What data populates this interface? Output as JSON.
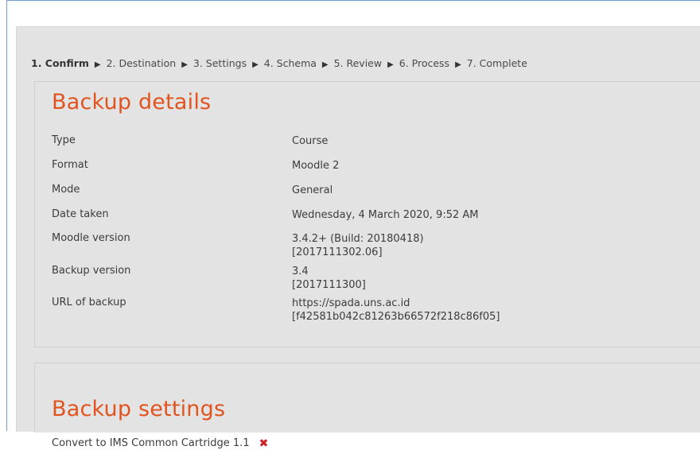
{
  "progress": {
    "steps": [
      "1. Confirm",
      "2. Destination",
      "3. Settings",
      "4. Schema",
      "5. Review",
      "6. Process",
      "7. Complete"
    ],
    "separator": "▶"
  },
  "backup_details": {
    "title": "Backup details",
    "rows": [
      {
        "label": "Type",
        "value": "Course"
      },
      {
        "label": "Format",
        "value": "Moodle 2"
      },
      {
        "label": "Mode",
        "value": "General"
      },
      {
        "label": "Date taken",
        "value": "Wednesday, 4 March 2020, 9:52 AM"
      },
      {
        "label": "Moodle version",
        "value_line1": "3.4.2+ (Build: 20180418)",
        "value_line2": "[2017111302.06]"
      },
      {
        "label": "Backup version",
        "value_line1": "3.4",
        "value_line2": "[2017111300]"
      },
      {
        "label": "URL of backup",
        "value_line1": "https://spada.uns.ac.id",
        "value_line2": "[f42581b042c81263b66572f218c86f05]"
      }
    ]
  },
  "backup_settings": {
    "title": "Backup settings",
    "rows": [
      {
        "label": "Convert to IMS Common Cartridge 1.1",
        "status_icon": "cross-icon",
        "status_color": "#cc1e1e",
        "status_glyph": "✖"
      }
    ]
  }
}
